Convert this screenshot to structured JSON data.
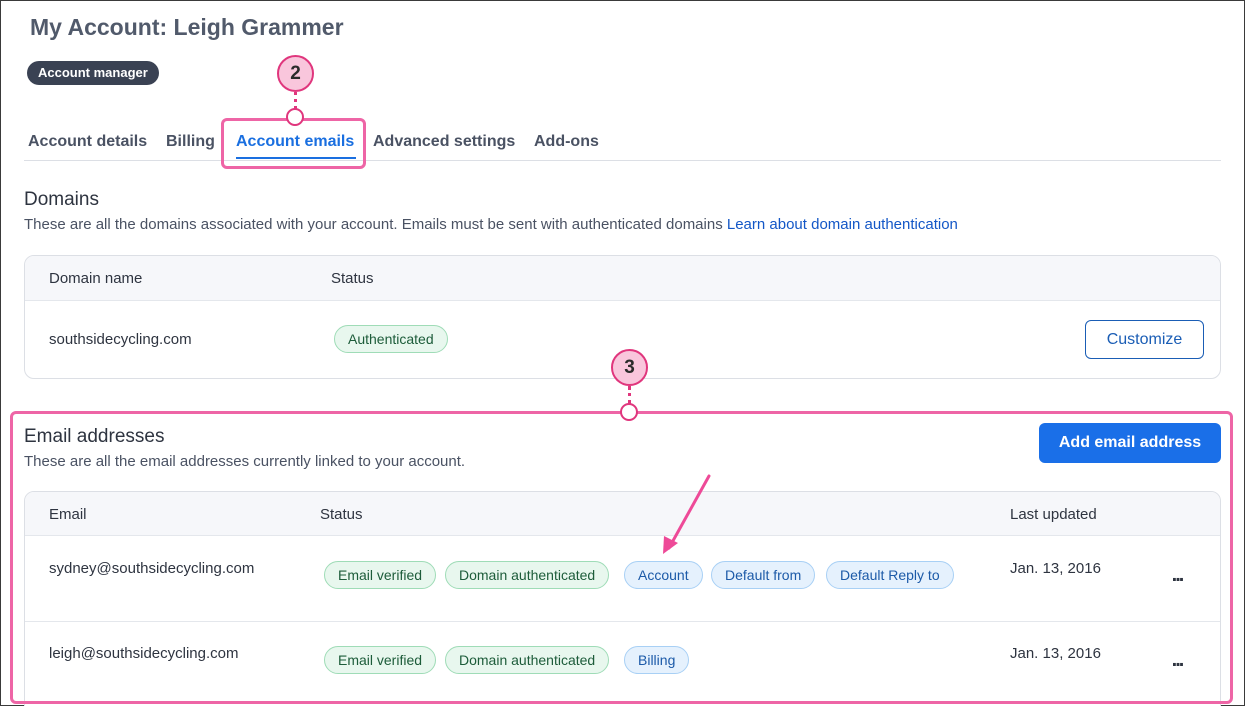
{
  "header": {
    "title": "My Account: Leigh Grammer",
    "role_badge": "Account manager"
  },
  "tabs": [
    {
      "label": "Account details"
    },
    {
      "label": "Billing"
    },
    {
      "label": "Account emails",
      "active": true
    },
    {
      "label": "Advanced settings"
    },
    {
      "label": "Add-ons"
    }
  ],
  "domains": {
    "title": "Domains",
    "description": "These are all the domains associated with your account. Emails must be sent with authenticated domains",
    "learn_link": "Learn about domain authentication",
    "columns": {
      "name": "Domain name",
      "status": "Status"
    },
    "rows": [
      {
        "domain": "southsidecycling.com",
        "status": "Authenticated",
        "action": "Customize"
      }
    ]
  },
  "email_addresses": {
    "title": "Email addresses",
    "description": "These are all the email addresses currently linked to your account.",
    "add_button": "Add email address",
    "columns": {
      "email": "Email",
      "status": "Status",
      "updated": "Last updated"
    },
    "rows": [
      {
        "email": "sydney@southsidecycling.com",
        "tags": [
          "Email verified",
          "Domain authenticated",
          "Account",
          "Default from",
          "Default Reply to"
        ],
        "updated": "Jan. 13, 2016",
        "menu": "..."
      },
      {
        "email": "leigh@southsidecycling.com",
        "tags": [
          "Email verified",
          "Domain authenticated",
          "Billing"
        ],
        "updated": "Jan. 13, 2016",
        "menu": "..."
      }
    ]
  },
  "callouts": {
    "step_tabs": "2",
    "step_emails": "3"
  },
  "colors": {
    "accent": "#1a6fe8",
    "callout": "#e0367d",
    "green_tag": "#e8f7ee",
    "blue_tag": "#e5f1fd"
  },
  "icons": {
    "row_menu": "more-horizontal-icon",
    "arrow": "arrow-annotation-icon"
  }
}
